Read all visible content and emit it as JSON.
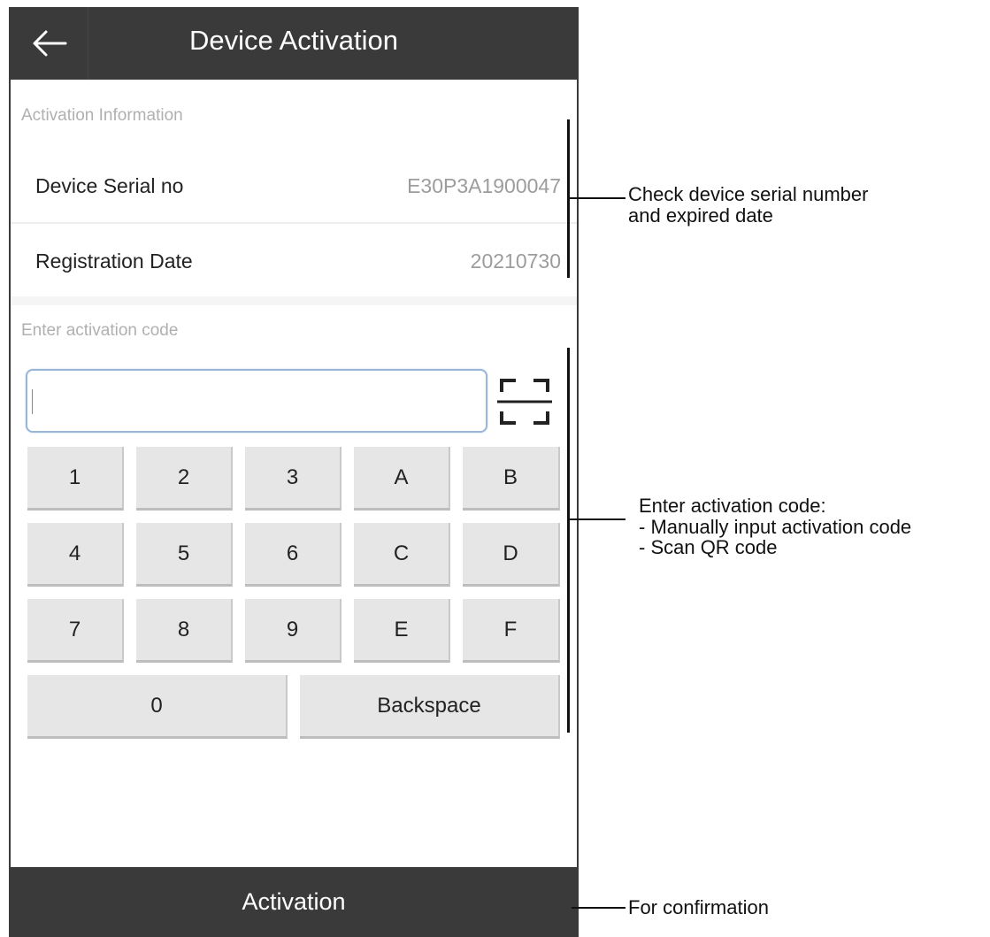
{
  "header": {
    "title": "Device Activation",
    "back_icon": "arrow-left-icon"
  },
  "activation_info": {
    "section_label": "Activation Information",
    "rows": [
      {
        "label": "Device Serial no",
        "value": "E30P3A1900047"
      },
      {
        "label": "Registration Date",
        "value": "20210730"
      }
    ]
  },
  "code_entry": {
    "section_label": "Enter activation code",
    "input_value": "",
    "input_placeholder": "",
    "scan_icon": "qr-scan-icon"
  },
  "keypad": {
    "rows": [
      [
        "1",
        "2",
        "3",
        "A",
        "B"
      ],
      [
        "4",
        "5",
        "6",
        "C",
        "D"
      ],
      [
        "7",
        "8",
        "9",
        "E",
        "F"
      ]
    ],
    "zero": "0",
    "backspace": "Backspace"
  },
  "footer": {
    "activation_label": "Activation"
  },
  "annotations": {
    "info_note_line1": "Check device serial number",
    "info_note_line2": "and expired date",
    "code_note_line1": "Enter activation code:",
    "code_note_line2": "- Manually input activation code",
    "code_note_line3": "- Scan QR code",
    "confirm_note": "For confirmation"
  },
  "colors": {
    "bar": "#3a3a3a",
    "key": "#e6e6e6",
    "input_border": "#9ab6d6"
  }
}
